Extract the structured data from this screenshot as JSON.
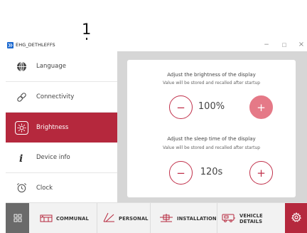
{
  "callout": {
    "number": "1"
  },
  "window": {
    "title": "EHG_DETHLEFFS",
    "minimize_glyph": "−",
    "maximize_glyph": "□",
    "close_glyph": "×"
  },
  "sidebar": {
    "items": [
      {
        "label": "Language",
        "icon": "globe-icon",
        "active": false
      },
      {
        "label": "Connectivity",
        "icon": "link-icon",
        "active": false
      },
      {
        "label": "Brightness",
        "icon": "sun-icon",
        "active": true
      },
      {
        "label": "Device info",
        "icon": "info-icon",
        "active": false
      },
      {
        "label": "Clock",
        "icon": "alarm-clock-icon",
        "active": false
      }
    ]
  },
  "brightness": {
    "title": "Adjust the brightness of the display",
    "subtitle": "Value will be stored and recalled after startup",
    "value": "100%",
    "decrease_glyph": "−",
    "increase_glyph": "+"
  },
  "sleep": {
    "title": "Adjust the sleep time of the display",
    "subtitle": "Value will be stored and recalled after startup",
    "value": "120s",
    "decrease_glyph": "−",
    "increase_glyph": "+"
  },
  "bottom_bar": {
    "grid_icon": "grid-icon",
    "tabs": [
      {
        "label": "COMMUNAL",
        "icon": "kitchen-icon"
      },
      {
        "label": "PERSONAL",
        "icon": "personal-icon"
      },
      {
        "label": "INSTALLATION",
        "icon": "installation-icon"
      },
      {
        "label": "VEHICLE DETAILS",
        "icon": "vehicle-icon"
      }
    ],
    "settings_icon": "gear-icon"
  },
  "colors": {
    "accent": "#b5283d",
    "accent_light": "#e57987",
    "main_bg": "#d6d6d6",
    "grid_bg": "#6a6a6a",
    "app_icon": "#1d6ad0"
  }
}
